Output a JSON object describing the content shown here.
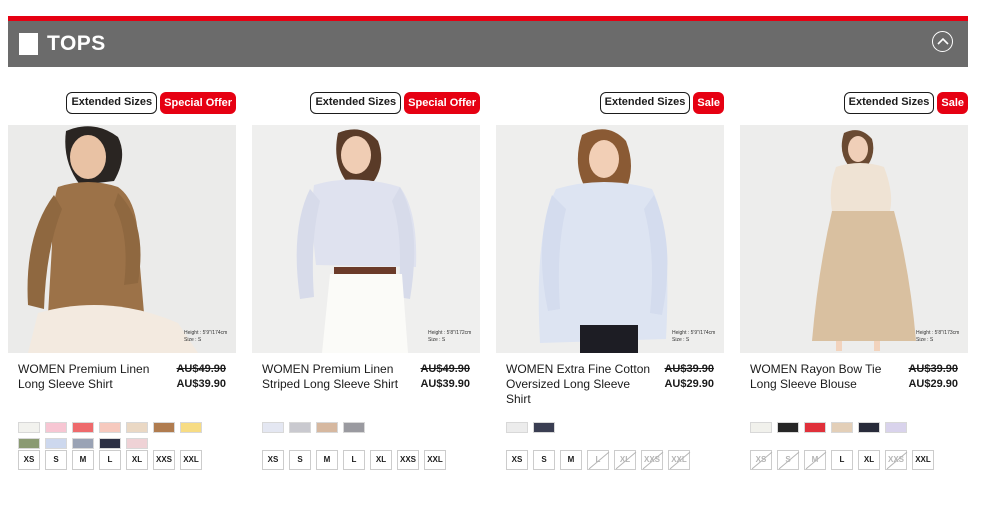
{
  "section": {
    "title": "TOPS"
  },
  "colors": {
    "accent": "#e60012",
    "header_bg": "#6b6b6b"
  },
  "icons": {
    "collapse": "chevron-up-circle-icon"
  },
  "products": [
    {
      "badges": [
        "Extended Sizes",
        "Special Offer"
      ],
      "name": "WOMEN Premium Linen Long Sleeve Shirt",
      "old_price": "AU$49.90",
      "price": "AU$39.90",
      "model_height": "Height : 5'9\"/174cm",
      "model_size": "Size : S",
      "swatches": [
        "#f2f2ee",
        "#f7c6d3",
        "#ee6a6c",
        "#f6c9be",
        "#ead8c4",
        "#b07c4f",
        "#f7dc84",
        "#8a9a72",
        "#cdd8ee",
        "#9aa3b5",
        "#2d3145",
        "#efd2d6"
      ],
      "sizes": [
        {
          "label": "XS",
          "available": true
        },
        {
          "label": "S",
          "available": true
        },
        {
          "label": "M",
          "available": true
        },
        {
          "label": "L",
          "available": true
        },
        {
          "label": "XL",
          "available": true
        },
        {
          "label": "XXS",
          "available": true
        },
        {
          "label": "XXL",
          "available": true
        }
      ]
    },
    {
      "badges": [
        "Extended Sizes",
        "Special Offer"
      ],
      "name": "WOMEN Premium Linen Striped Long Sleeve Shirt",
      "old_price": "AU$49.90",
      "price": "AU$39.90",
      "model_height": "Height : 5'8\"/172cm",
      "model_size": "Size : S",
      "swatches": [
        "#e4e7f2",
        "#c9c9cf",
        "#d6b8a0",
        "#9a9aa0"
      ],
      "sizes": [
        {
          "label": "XS",
          "available": true
        },
        {
          "label": "S",
          "available": true
        },
        {
          "label": "M",
          "available": true
        },
        {
          "label": "L",
          "available": true
        },
        {
          "label": "XL",
          "available": true
        },
        {
          "label": "XXS",
          "available": true
        },
        {
          "label": "XXL",
          "available": true
        }
      ]
    },
    {
      "badges": [
        "Extended Sizes",
        "Sale"
      ],
      "name": "WOMEN Extra Fine Cotton Oversized Long Sleeve Shirt",
      "old_price": "AU$39.90",
      "price": "AU$29.90",
      "model_height": "Height : 5'9\"/174cm",
      "model_size": "Size : S",
      "swatches": [
        "#ececec",
        "#3a3e52"
      ],
      "sizes": [
        {
          "label": "XS",
          "available": true
        },
        {
          "label": "S",
          "available": true
        },
        {
          "label": "M",
          "available": true
        },
        {
          "label": "L",
          "available": false
        },
        {
          "label": "XL",
          "available": false
        },
        {
          "label": "XXS",
          "available": false
        },
        {
          "label": "XXL",
          "available": false
        }
      ]
    },
    {
      "badges": [
        "Extended Sizes",
        "Sale"
      ],
      "name": "WOMEN Rayon Bow Tie Long Sleeve Blouse",
      "old_price": "AU$39.90",
      "price": "AU$29.90",
      "model_height": "Height : 5'8\"/173cm",
      "model_size": "Size : S",
      "swatches": [
        "#f1f1ec",
        "#262626",
        "#e0303a",
        "#e3cfb8",
        "#282b3a",
        "#d9d3ec"
      ],
      "sizes": [
        {
          "label": "XS",
          "available": false
        },
        {
          "label": "S",
          "available": false
        },
        {
          "label": "M",
          "available": false
        },
        {
          "label": "L",
          "available": true
        },
        {
          "label": "XL",
          "available": true
        },
        {
          "label": "XXS",
          "available": false
        },
        {
          "label": "XXL",
          "available": true
        }
      ]
    }
  ]
}
